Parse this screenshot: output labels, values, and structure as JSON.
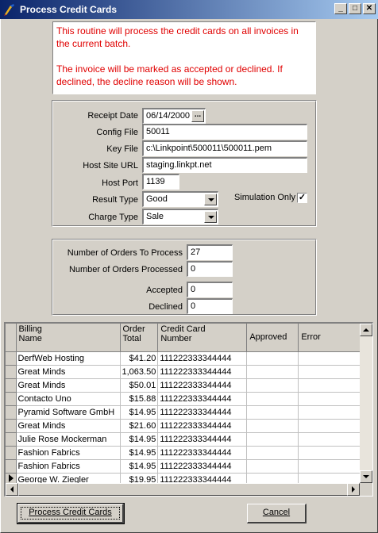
{
  "window": {
    "title": "Process Credit Cards",
    "minimize_label": "_",
    "maximize_label": "□",
    "close_label": "✕"
  },
  "info": {
    "line1": "This routine will process the credit cards on all invoices in the current batch.",
    "line2": "The invoice will be marked as accepted or declined.  If declined, the decline reason will be shown."
  },
  "settings": {
    "receipt_date_label": "Receipt Date",
    "receipt_date_value": "06/14/2000",
    "receipt_date_button": "...",
    "config_file_label": "Config File",
    "config_file_value": "50011",
    "key_file_label": "Key File",
    "key_file_value": "c:\\Linkpoint\\500011\\500011.pem",
    "host_url_label": "Host Site URL",
    "host_url_value": "staging.linkpt.net",
    "host_port_label": "Host Port",
    "host_port_value": "1139",
    "result_type_label": "Result Type",
    "result_type_value": "Good",
    "charge_type_label": "Charge Type",
    "charge_type_value": "Sale",
    "simulation_label": "Simulation Only",
    "simulation_checked": "✓"
  },
  "counts": {
    "to_process_label": "Number of Orders To Process",
    "to_process_value": "27",
    "processed_label": "Number of Orders Processed",
    "processed_value": "0",
    "accepted_label": "Accepted",
    "accepted_value": "0",
    "declined_label": "Declined",
    "declined_value": "0"
  },
  "grid": {
    "headers": {
      "billing_name_1": "Billing",
      "billing_name_2": "Name",
      "order_total_1": "Order",
      "order_total_2": "Total",
      "credit_card_1": "Credit Card",
      "credit_card_2": "Number",
      "approved": "Approved",
      "error": "Error"
    },
    "rows": [
      {
        "name": "DerfWeb Hosting",
        "total": "$41.20",
        "card": "111222333344444"
      },
      {
        "name": "Great Minds",
        "total": "1,063.50",
        "card": "111222333344444"
      },
      {
        "name": "Great Minds",
        "total": "$50.01",
        "card": "111222333344444"
      },
      {
        "name": "Contacto Uno",
        "total": "$15.88",
        "card": "111222333344444"
      },
      {
        "name": "Pyramid Software GmbH",
        "total": "$14.95",
        "card": "111222333344444"
      },
      {
        "name": "Great Minds",
        "total": "$21.60",
        "card": "111222333344444"
      },
      {
        "name": "Julie Rose Mockerman",
        "total": "$14.95",
        "card": "111222333344444"
      },
      {
        "name": "Fashion Fabrics",
        "total": "$14.95",
        "card": "111222333344444"
      },
      {
        "name": "Fashion Fabrics",
        "total": "$14.95",
        "card": "111222333344444"
      },
      {
        "name": "George W. Ziegler",
        "total": "$19.95",
        "card": "111222333344444"
      }
    ]
  },
  "buttons": {
    "process": "Process Credit Cards",
    "cancel": "Cancel"
  },
  "colors": {
    "info_text": "#e00000",
    "title_bar": "#0a246a",
    "face": "#d4d0c8"
  }
}
